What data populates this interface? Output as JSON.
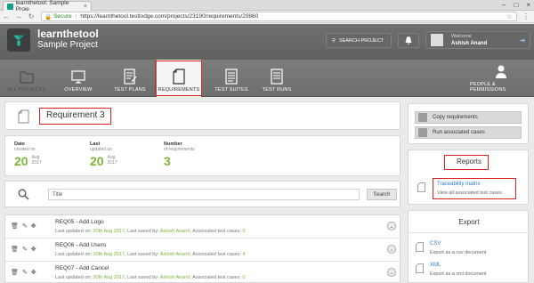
{
  "browser": {
    "tab_title": "learnthetool: Sample Proje",
    "secure_label": "Secure",
    "url": "https://learnthetool.testlodge.com/projects/23190/requirements/20860"
  },
  "header": {
    "brand": "learnthetool",
    "project": "Sample Project",
    "search_label": "SEARCH PROJECT",
    "welcome": "Welcome",
    "user_name": "Ashish Anand"
  },
  "nav": {
    "items": [
      {
        "label": "ALL PROJECTS",
        "icon": "folder-icon"
      },
      {
        "label": "OVERVIEW",
        "icon": "monitor-icon"
      },
      {
        "label": "TEST PLANS",
        "icon": "test-plan-icon"
      },
      {
        "label": "REQUIREMENTS",
        "icon": "document-icon",
        "active": true
      },
      {
        "label": "TEST SUITES",
        "icon": "test-suite-icon"
      },
      {
        "label": "TEST RUNS",
        "icon": "test-run-icon"
      },
      {
        "label": "PEOPLE & PERMISSIONS",
        "icon": "person-icon"
      }
    ]
  },
  "requirement": {
    "title": "Requirement 3"
  },
  "stats": {
    "date": {
      "label": "Date",
      "sub": "created on",
      "day": "20",
      "month": "Aug",
      "year": "2017"
    },
    "last": {
      "label": "Last",
      "sub": "updated on",
      "day": "20",
      "month": "Aug",
      "year": "2017"
    },
    "number": {
      "label": "Number",
      "sub": "of requirements",
      "value": "3"
    }
  },
  "search": {
    "placeholder": "Title",
    "button": "Search"
  },
  "list": [
    {
      "name": "REQ05 - Add Logo",
      "updated": "20th Aug 2017",
      "saved_by": "Ashish Anand",
      "cases": "0"
    },
    {
      "name": "REQ06 - Add Users",
      "updated": "20th Aug 2017",
      "saved_by": "Ashish Anand",
      "cases": "4"
    },
    {
      "name": "REQ07 - Add Cancel",
      "updated": "20th Aug 2017",
      "saved_by": "Ashish Anand",
      "cases": "0"
    }
  ],
  "list_labels": {
    "last_updated": "Last updated on:",
    "last_saved": "Last saved by:",
    "assoc": "Associated test cases:"
  },
  "side": {
    "copy": "Copy requirements",
    "run": "Run associated cases"
  },
  "reports": {
    "heading": "Reports",
    "link": "Traceability matrix",
    "desc": "View all associated test cases"
  },
  "export": {
    "heading": "Export",
    "csv": "CSV",
    "csv_desc": "Export as a csv document",
    "xml": "XML",
    "xml_desc": "Export as a xml document"
  },
  "colors": {
    "accent_green": "#7db536",
    "link_blue": "#2a7ac6",
    "highlight_red": "#e02020"
  }
}
